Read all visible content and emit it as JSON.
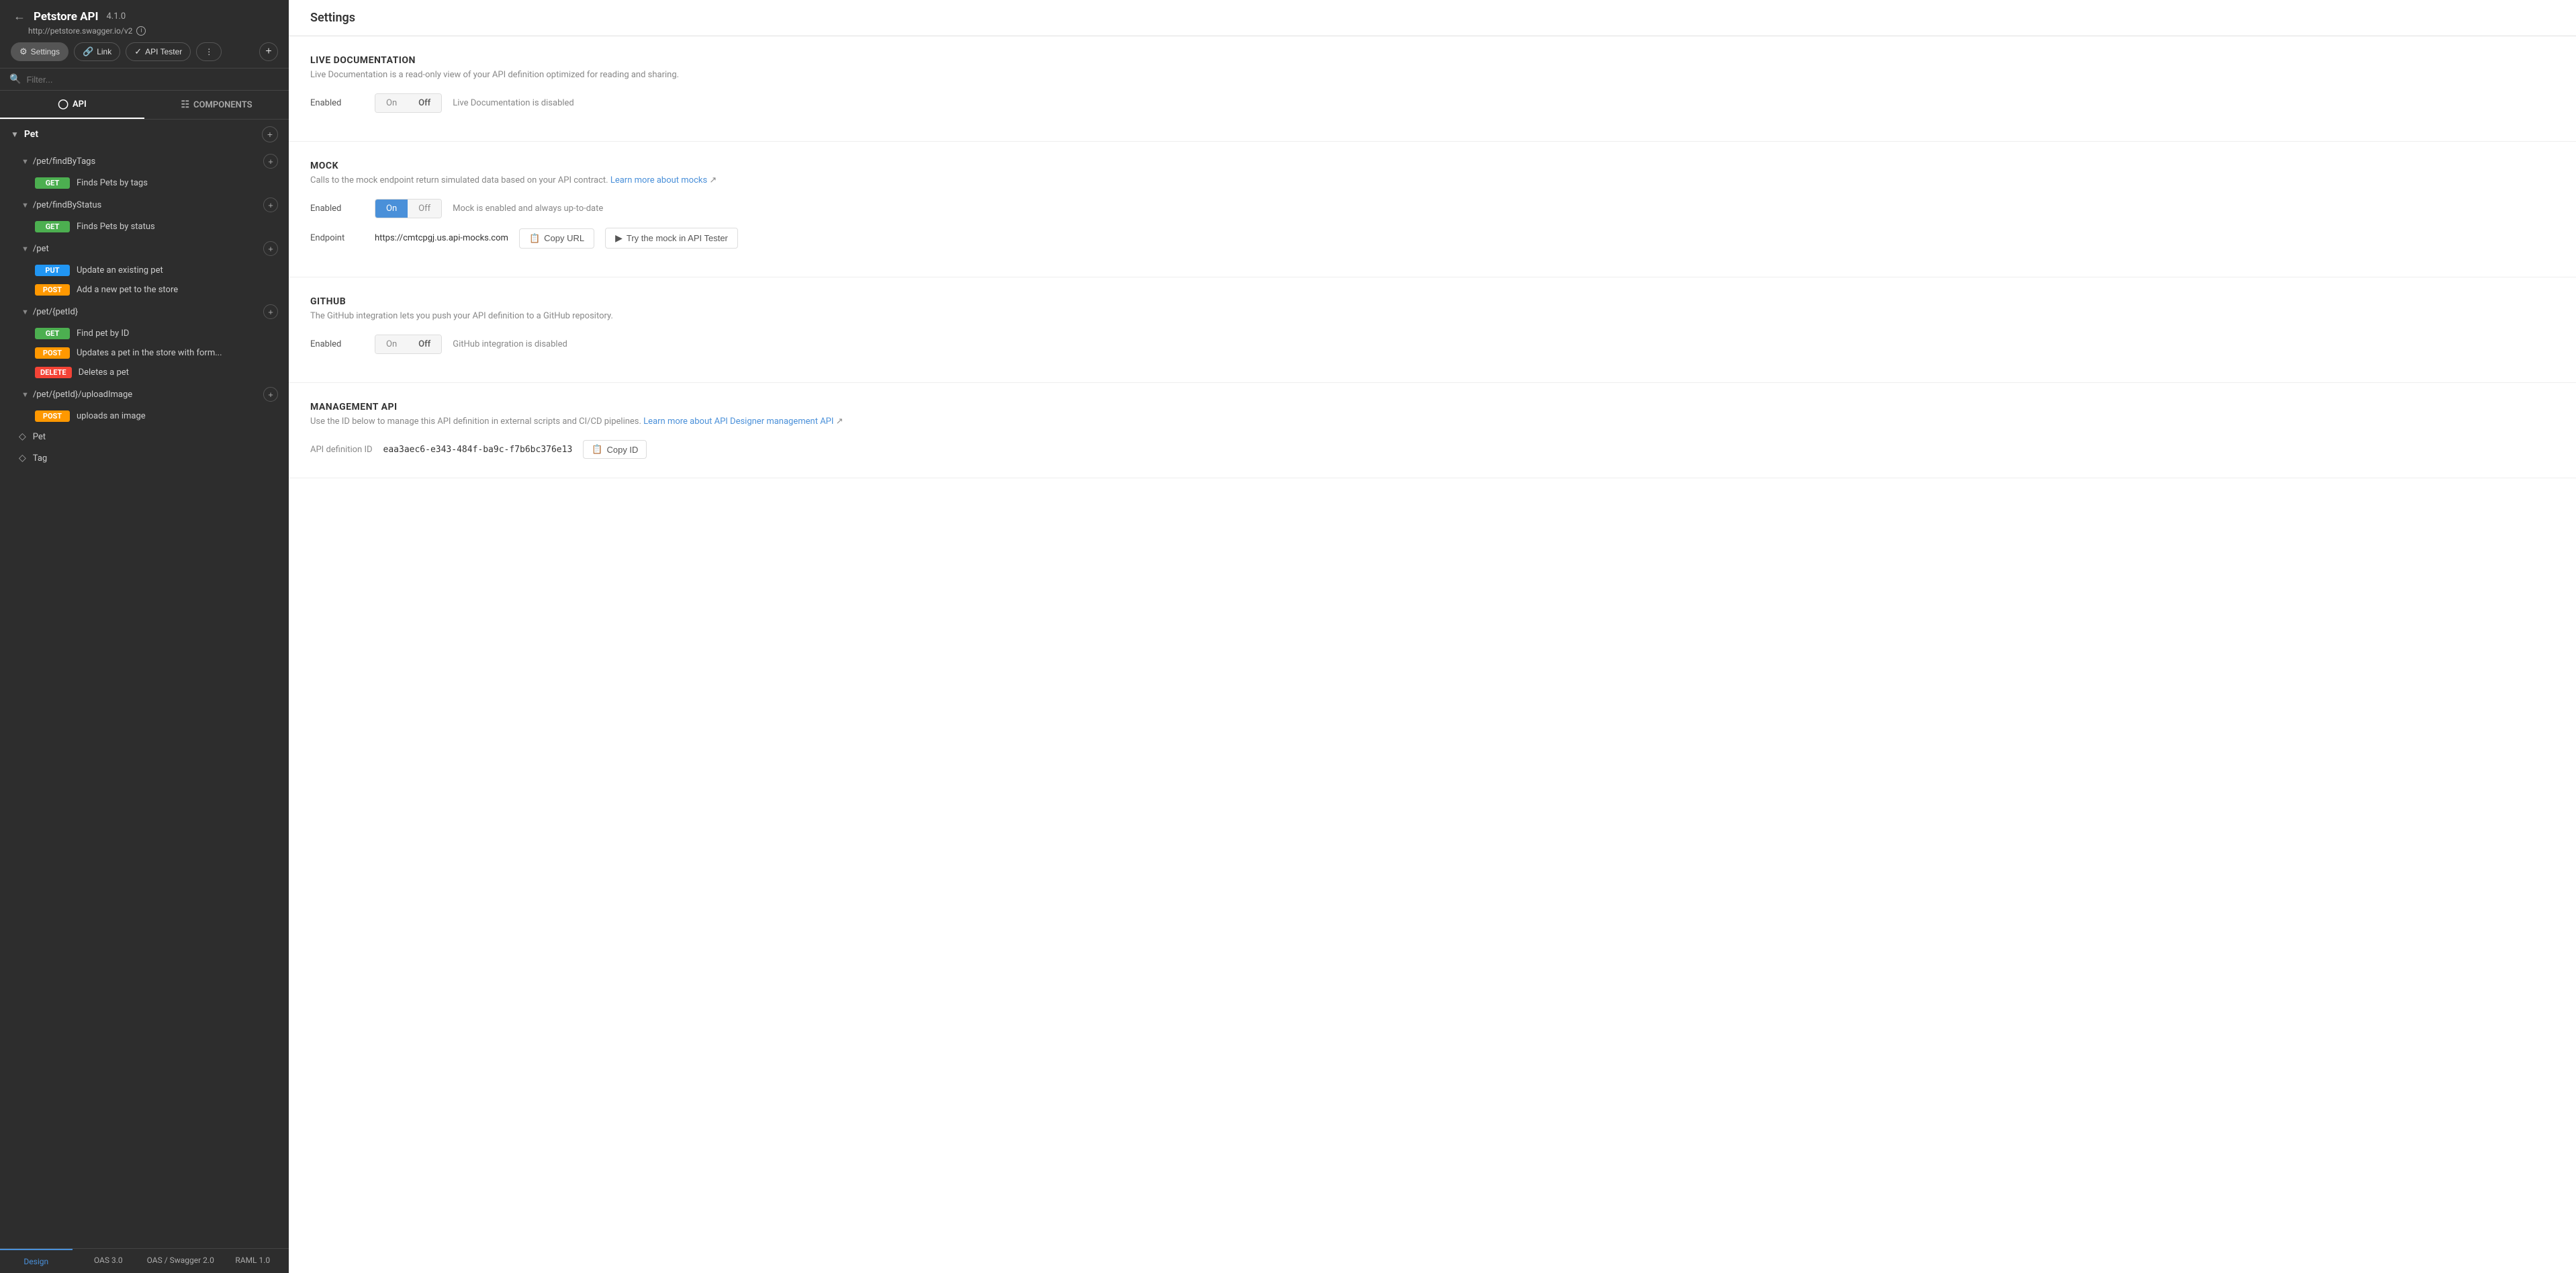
{
  "sidebar": {
    "api_title": "Petstore API",
    "api_version": "4.1.0",
    "api_url": "http://petstore.swagger.io/v2",
    "back_icon": "←",
    "info_icon": "ℹ",
    "buttons": {
      "settings": "Settings",
      "link": "Link",
      "api_tester": "API Tester",
      "share": "⋯",
      "add": "+"
    },
    "filter_placeholder": "Filter...",
    "tabs": [
      {
        "id": "api",
        "label": "API",
        "icon": "⊙"
      },
      {
        "id": "components",
        "label": "COMPONENTS",
        "icon": "⊞"
      }
    ],
    "sections": [
      {
        "id": "pet",
        "label": "Pet",
        "routes": [
          {
            "path": "/pet/findByTags",
            "methods": [
              {
                "type": "GET",
                "label": "Finds Pets by tags"
              }
            ]
          },
          {
            "path": "/pet/findByStatus",
            "methods": [
              {
                "type": "GET",
                "label": "Finds Pets by status"
              }
            ]
          },
          {
            "path": "/pet",
            "methods": [
              {
                "type": "PUT",
                "label": "Update an existing pet"
              },
              {
                "type": "POST",
                "label": "Add a new pet to the store"
              }
            ]
          },
          {
            "path": "/pet/{petId}",
            "methods": [
              {
                "type": "GET",
                "label": "Find pet by ID"
              },
              {
                "type": "POST",
                "label": "Updates a pet in the store with form..."
              },
              {
                "type": "DELETE",
                "label": "Deletes a pet"
              }
            ]
          },
          {
            "path": "/pet/{petId}/uploadImage",
            "methods": [
              {
                "type": "POST",
                "label": "uploads an image"
              }
            ]
          }
        ]
      }
    ],
    "schemas": [
      {
        "label": "Pet"
      },
      {
        "label": "Tag"
      }
    ],
    "bottom_tabs": [
      {
        "label": "Design",
        "active": true
      },
      {
        "label": "OAS 3.0"
      },
      {
        "label": "OAS / Swagger 2.0"
      },
      {
        "label": "RAML 1.0"
      }
    ]
  },
  "main": {
    "title": "Settings",
    "sections": [
      {
        "id": "live_documentation",
        "title": "LIVE DOCUMENTATION",
        "description": "Live Documentation is a read-only view of your API definition optimized for reading and sharing.",
        "enabled_label": "Enabled",
        "toggle": {
          "on_label": "On",
          "off_label": "Off",
          "state": "off"
        },
        "status_text": "Live Documentation is disabled"
      },
      {
        "id": "mock",
        "title": "MOCK",
        "description": "Calls to the mock endpoint return simulated data based on your API contract.",
        "learn_more_text": "Learn more about mocks",
        "learn_more_link": "#",
        "enabled_label": "Enabled",
        "toggle": {
          "on_label": "On",
          "off_label": "Off",
          "state": "on"
        },
        "status_text": "Mock is enabled and always up-to-date",
        "endpoint_label": "Endpoint",
        "endpoint_url": "https://cmtcpgj.us.api-mocks.com",
        "copy_url_label": "Copy URL",
        "try_mock_label": "Try the mock in API Tester"
      },
      {
        "id": "github",
        "title": "GITHUB",
        "description": "The GitHub integration lets you push your API definition to a GitHub repository.",
        "enabled_label": "Enabled",
        "toggle": {
          "on_label": "On",
          "off_label": "Off",
          "state": "off"
        },
        "status_text": "GitHub integration is disabled"
      },
      {
        "id": "management_api",
        "title": "MANAGEMENT API",
        "description": "Use the ID below to manage this API definition in external scripts and CI/CD pipelines.",
        "learn_more_text": "Learn more about API Designer management API",
        "learn_more_link": "#",
        "api_def_label": "API definition ID",
        "api_def_id": "eaa3aec6-e343-484f-ba9c-f7b6bc376e13",
        "copy_id_label": "Copy ID"
      }
    ]
  }
}
